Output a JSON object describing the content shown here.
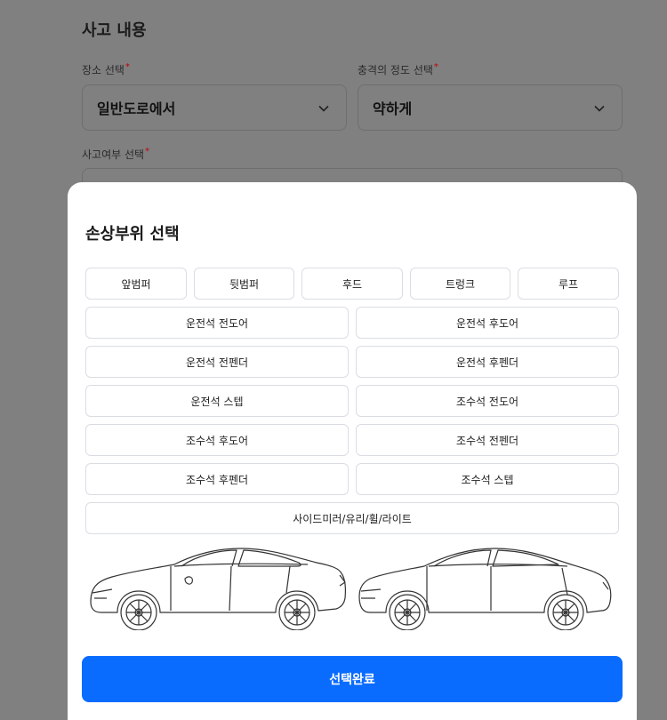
{
  "background_form": {
    "section_title": "사고 내용",
    "place_label": "장소 선택",
    "place_value": "일반도로에서",
    "impact_label": "충격의 정도 선택",
    "impact_value": "약하게",
    "accident_label": "사고여부 선택",
    "required_mark": "*"
  },
  "modal": {
    "title": "손상부위 선택",
    "parts": {
      "row1": [
        "앞범퍼",
        "뒷범퍼",
        "후드",
        "트렁크",
        "루프"
      ],
      "driver_front_door": "운전석 전도어",
      "driver_rear_door": "운전석 후도어",
      "driver_front_fender": "운전석 전펜더",
      "driver_rear_fender": "운전석 후펜더",
      "driver_step": "운전석 스텝",
      "passenger_front_door": "조수석 전도어",
      "passenger_rear_door": "조수석 후도어",
      "passenger_front_fender": "조수석 전펜더",
      "passenger_rear_fender": "조수석 후펜더",
      "passenger_step": "조수석 스텝",
      "misc": "사이드미러/유리/휠/라이트"
    },
    "confirm_label": "선택완료"
  },
  "colors": {
    "overlay": "#808080",
    "primary": "#0a6cff",
    "required": "#c0000a",
    "option_border": "#d9dde3"
  }
}
